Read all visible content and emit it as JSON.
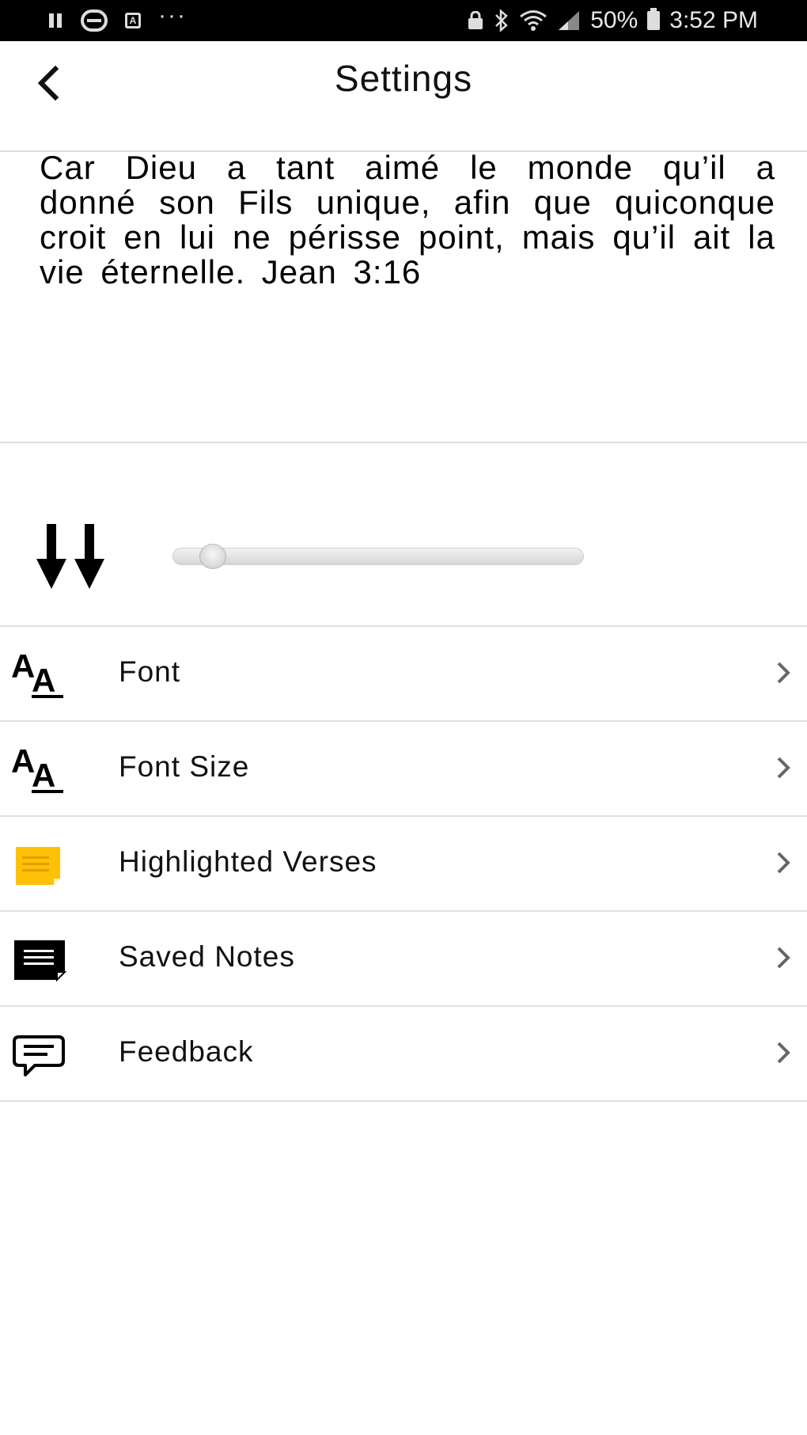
{
  "status_bar": {
    "battery": "50%",
    "time": "3:52 PM",
    "left_icons": [
      "pause-icon",
      "printer-icon",
      "app-a-icon",
      "more-dots-icon"
    ],
    "right_icons": [
      "lock-icon",
      "bluetooth-icon",
      "wifi-icon",
      "signal-icon",
      "battery-icon"
    ]
  },
  "header": {
    "title": "Settings",
    "back_icon": "chevron-left-icon"
  },
  "verse_preview": {
    "text": "Car Dieu a tant aimé le monde qu’il a donné son Fils unique, afin que quiconque croit en lui ne périsse point, mais qu’il ait la vie éternelle. Jean 3:16"
  },
  "scroll_speed": {
    "icon": "double-down-arrow-icon",
    "value_fraction": 0.06
  },
  "menu": {
    "items": [
      {
        "label": "Font",
        "icon": "font-icon"
      },
      {
        "label": "Font Size",
        "icon": "font-size-icon"
      },
      {
        "label": "Highlighted Verses",
        "icon": "sticky-note-icon",
        "icon_color": "#FFC107"
      },
      {
        "label": "Saved Notes",
        "icon": "note-icon",
        "icon_color": "#000000"
      },
      {
        "label": "Feedback",
        "icon": "chat-bubble-icon"
      }
    ],
    "chevron_color": "#666666"
  }
}
